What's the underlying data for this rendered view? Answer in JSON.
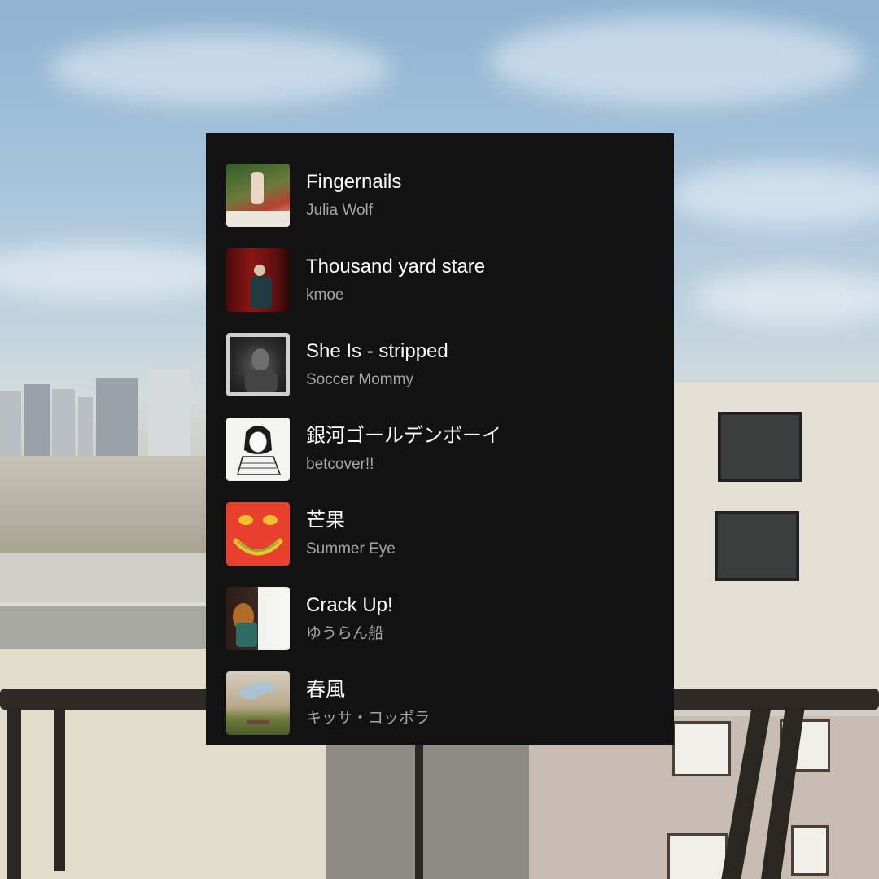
{
  "playlist": {
    "tracks": [
      {
        "title": "Fingernails",
        "artist": "Julia Wolf",
        "art_icon": "album-art-fingernails"
      },
      {
        "title": "Thousand yard stare",
        "artist": "kmoe",
        "art_icon": "album-art-thousand-yard-stare"
      },
      {
        "title": "She Is - stripped",
        "artist": "Soccer Mommy",
        "art_icon": "album-art-she-is"
      },
      {
        "title": "銀河ゴールデンボーイ",
        "artist": "betcover!!",
        "art_icon": "album-art-ginga"
      },
      {
        "title": "芒果",
        "artist": "Summer Eye",
        "art_icon": "album-art-mango"
      },
      {
        "title": "Crack Up!",
        "artist": "ゆうらん船",
        "art_icon": "album-art-crack-up"
      },
      {
        "title": "春風",
        "artist": "キッサ・コッポラ",
        "art_icon": "album-art-harukaze"
      }
    ]
  },
  "colors": {
    "card_background": "#121212",
    "title_text": "#ffffff",
    "artist_text": "#a7a7a7"
  }
}
